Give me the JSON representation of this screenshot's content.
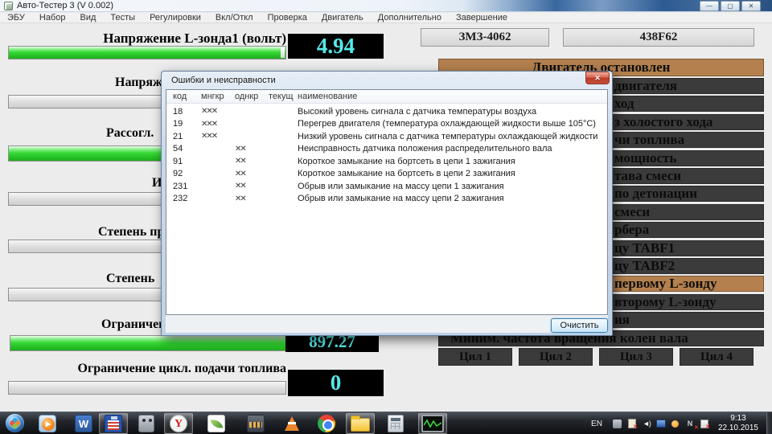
{
  "colors": {
    "accent_brown": "#b3804e",
    "bar_green": "#2fd32f",
    "value_cyan": "#55eaea",
    "panel_dark": "#3b3b3b"
  },
  "window": {
    "title": "Авто-Тестер 3  (V 0.002)",
    "controls": {
      "minimize": "—",
      "maximize": "▢",
      "close": "✕"
    },
    "menu": [
      "ЭБУ",
      "Набор",
      "Вид",
      "Тесты",
      "Регулировки",
      "Вкл/Откл",
      "Проверка",
      "Двигатель",
      "Дополнительно",
      "Завершение"
    ]
  },
  "ecu": {
    "left": "ЗМЗ-4062",
    "right": "438F62"
  },
  "gauges": {
    "g1": {
      "label": "Напряжение L-зонда1 (вольт)",
      "value": "4.94"
    },
    "g2": {
      "label": "Напряж"
    },
    "g3": {
      "label": "Рассогл."
    },
    "g4": {
      "label": "Ин"
    },
    "g5": {
      "label": "Степень пр"
    },
    "g6": {
      "label": "Степень"
    },
    "g7": {
      "label": "Ограничен",
      "value": "897.27"
    },
    "g8": {
      "label": "Ограничение цикл. подачи топлива",
      "value": "0"
    }
  },
  "right_panel": {
    "status": "Двигатель остановлен",
    "rows": [
      {
        "text": "двигателя"
      },
      {
        "text": "ход"
      },
      {
        "text": "з холостого хода"
      },
      {
        "text": "чи топлива"
      },
      {
        "text": "мощность"
      },
      {
        "text": "тава смеси"
      },
      {
        "text": "по детонации"
      },
      {
        "text": "смеси"
      },
      {
        "text": "рбера"
      },
      {
        "text": "цу TABF1"
      },
      {
        "text": "цу TABF2"
      },
      {
        "text": "первому L-зонду",
        "selected": true
      },
      {
        "text": "второму L-зонду"
      },
      {
        "text": "ия"
      },
      {
        "text": "Миним. частота вращения колен вала",
        "full": true
      }
    ],
    "cylinders": [
      "Цил 1",
      "Цил 2",
      "Цил 3",
      "Цил 4"
    ]
  },
  "dialog": {
    "title": "Ошибки и неисправности",
    "close": "✕",
    "columns": [
      "код",
      "мнгкр",
      "однкр",
      "текущ",
      "наименование"
    ],
    "rows": [
      {
        "code": "18",
        "multi": "✕✕✕",
        "single": "",
        "current": "",
        "name": "Высокий уровень сигнала с датчика температуры воздуха"
      },
      {
        "code": "19",
        "multi": "✕✕✕",
        "single": "",
        "current": "",
        "name": "Перегрев двигателя (температура охлаждающей жидкости выше 105°С)"
      },
      {
        "code": "21",
        "multi": "✕✕✕",
        "single": "",
        "current": "",
        "name": "Низкий уровень сигнала с датчика температуры охлаждающей жидкости"
      },
      {
        "code": "54",
        "multi": "",
        "single": "✕✕",
        "current": "",
        "name": "Неисправность датчика положения распределительного вала"
      },
      {
        "code": "91",
        "multi": "",
        "single": "✕✕",
        "current": "",
        "name": "Короткое замыкание на бортсеть в цепи 1 зажигания"
      },
      {
        "code": "92",
        "multi": "",
        "single": "✕✕",
        "current": "",
        "name": "Короткое замыкание на бортсеть в цепи 2 зажигания"
      },
      {
        "code": "231",
        "multi": "",
        "single": "✕✕",
        "current": "",
        "name": "Обрыв или замыкание на массу цепи 1 зажигания"
      },
      {
        "code": "232",
        "multi": "",
        "single": "✕✕",
        "current": "",
        "name": "Обрыв или замыкание на массу цепи 2 зажигания"
      }
    ],
    "clear": "Очистить"
  },
  "taskbar": {
    "icons": [
      {
        "name": "start"
      },
      {
        "name": "media-player",
        "letter": "▶"
      },
      {
        "name": "word",
        "letter": "W"
      },
      {
        "name": "save",
        "active": true
      },
      {
        "name": "robot-app"
      },
      {
        "name": "yandex-browser",
        "letter": "Y",
        "active": true
      },
      {
        "name": "graphics-feather"
      },
      {
        "name": "movie-maker"
      },
      {
        "name": "vlc"
      },
      {
        "name": "chrome"
      },
      {
        "name": "explorer-folder",
        "active": true
      },
      {
        "name": "calculator"
      },
      {
        "name": "auto-tester-oscilloscope",
        "active": true
      }
    ],
    "tray": {
      "lang": "EN",
      "time": "9:13",
      "date": "22.10.2015"
    }
  }
}
